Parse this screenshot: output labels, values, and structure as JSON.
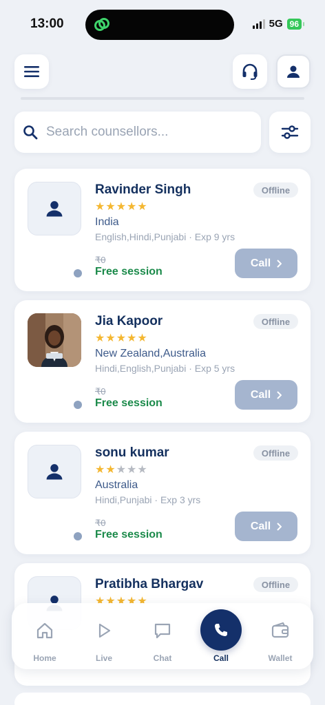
{
  "status_bar": {
    "time": "13:00",
    "network": "5G",
    "battery": "96"
  },
  "header": {
    "menu_icon": "hamburger-menu-icon",
    "support_icon": "headset-icon",
    "profile_icon": "user-icon"
  },
  "search": {
    "placeholder": "Search counsellors...",
    "value": ""
  },
  "counsellors": [
    {
      "name": "Ravinder Singh",
      "rating": 5,
      "country": "India",
      "languages": "English,Hindi,Punjabi · Exp 9 yrs",
      "old_price": "₹0",
      "price_label": "Free session",
      "status": "Offline",
      "call_label": "Call",
      "has_photo": false
    },
    {
      "name": "Jia Kapoor",
      "rating": 5,
      "country": "New Zealand,Australia",
      "languages": "Hindi,English,Punjabi · Exp 5 yrs",
      "old_price": "₹0",
      "price_label": "Free session",
      "status": "Offline",
      "call_label": "Call",
      "has_photo": true
    },
    {
      "name": "sonu kumar",
      "rating": 2,
      "country": "Australia",
      "languages": "Hindi,Punjabi · Exp 3 yrs",
      "old_price": "₹0",
      "price_label": "Free session",
      "status": "Offline",
      "call_label": "Call",
      "has_photo": false
    },
    {
      "name": "Pratibha Bhargav",
      "rating": 5,
      "status": "Offline",
      "has_photo": false
    }
  ],
  "bottom_nav": {
    "items": [
      {
        "label": "Home",
        "icon": "home-icon"
      },
      {
        "label": "Live",
        "icon": "play-icon"
      },
      {
        "label": "Chat",
        "icon": "chat-bubble-icon"
      },
      {
        "label": "Call",
        "icon": "phone-icon",
        "active": true
      },
      {
        "label": "Wallet",
        "icon": "wallet-icon"
      }
    ]
  },
  "colors": {
    "primary": "#14306a",
    "accent_green": "#1b8a4a",
    "star": "#f4b731",
    "call_button": "#a5b5cf",
    "background": "#eef1f6"
  }
}
